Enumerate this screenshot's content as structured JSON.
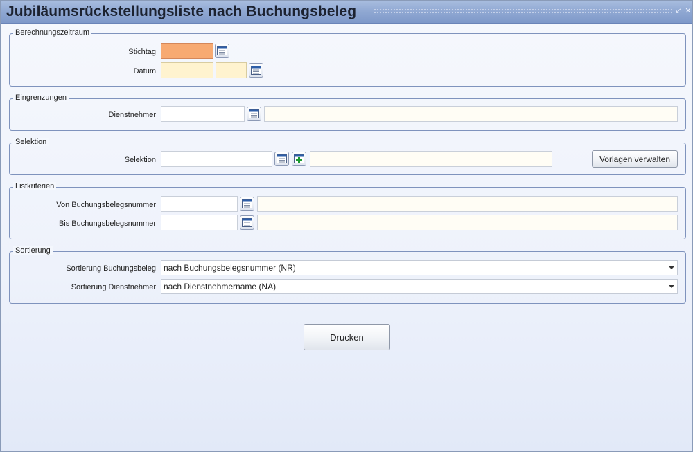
{
  "window": {
    "title": "Jubiläumsrückstellungsliste nach Buchungsbeleg",
    "minimize_glyph": "↙",
    "close_glyph": "✕"
  },
  "berechnungszeitraum": {
    "legend": "Berechnungszeitraum",
    "stichtag_label": "Stichtag",
    "stichtag_value": "",
    "datum_label": "Datum",
    "datum_value_1": "",
    "datum_value_2": ""
  },
  "eingrenzungen": {
    "legend": "Eingrenzungen",
    "dienstnehmer_label": "Dienstnehmer",
    "dienstnehmer_value": "",
    "dienstnehmer_name": ""
  },
  "selektion": {
    "legend": "Selektion",
    "selektion_label": "Selektion",
    "selektion_value": "",
    "selektion_description": "",
    "vorlagen_button": "Vorlagen verwalten"
  },
  "listkriterien": {
    "legend": "Listkriterien",
    "von_label": "Von Buchungsbelegsnummer",
    "von_value": "",
    "von_description": "",
    "bis_label": "Bis Buchungsbelegsnummer",
    "bis_value": "",
    "bis_description": ""
  },
  "sortierung": {
    "legend": "Sortierung",
    "buchungsbeleg_label": "Sortierung Buchungsbeleg",
    "buchungsbeleg_value": "nach Buchungsbelegsnummer (NR)",
    "dienstnehmer_label": "Sortierung Dienstnehmer",
    "dienstnehmer_value": "nach Dienstnehmername (NA)"
  },
  "actions": {
    "print_button": "Drucken"
  },
  "colors": {
    "required_field": "#fff3cf",
    "focused_field": "#f7aa72",
    "titlebar": "#8fa7d2",
    "group_border": "#7f93bd"
  },
  "icons": {
    "lookup": "calendar-lookup-icon",
    "add": "add-plus-icon"
  }
}
